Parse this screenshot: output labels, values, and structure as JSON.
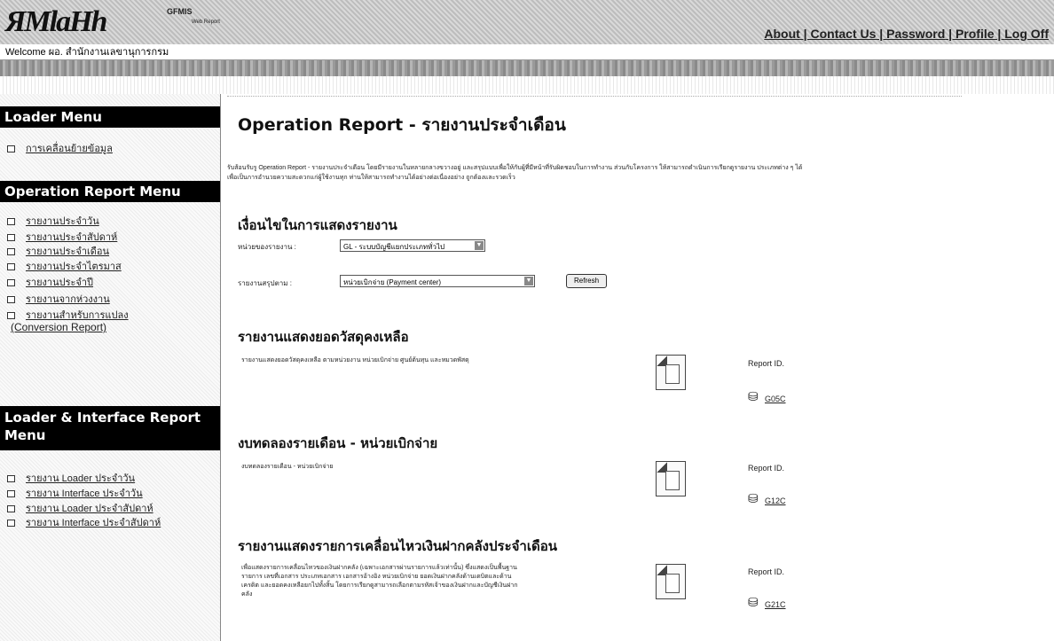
{
  "header": {
    "logo": "ЯMlaHh",
    "logo_sub": "GFMIS",
    "logo_sub2": "Web Report",
    "links": [
      "About",
      "Contact Us",
      "Password",
      "Profile",
      "Log Off"
    ],
    "separator": " | "
  },
  "welcome": "Welcome  ผอ. สำนักงานเลขานุการกรม",
  "sidebar": {
    "loader_menu": {
      "title": "Loader Menu",
      "items": [
        "การเคลื่อนย้ายข้อมูล"
      ]
    },
    "operation_menu": {
      "title": "Operation Report Menu",
      "items": [
        "รายงานประจำวัน",
        "รายงานประจำสัปดาห์",
        "รายงานประจำเดือน",
        "รายงานประจำไตรมาส",
        "รายงานประจำปี",
        "รายงานจากห่วงงาน",
        "รายงานสำหรับการแปลง",
        "(Conversion Report)"
      ]
    },
    "loader_interface_menu": {
      "title_line1": "Loader & Interface Report",
      "title_line2": "Menu",
      "items": [
        "รายงาน Loader ประจำวัน",
        "รายงาน Interface ประจำวัน",
        "รายงาน Loader ประจำสัปดาห์",
        "รายงาน Interface ประจำสัปดาห์"
      ]
    }
  },
  "main": {
    "title": "Operation Report -  รายงานประจำเดือน",
    "description_line1": "รับส้อนรับรู Operation Report - รายงานประจำเดือน โดยมีรายงานในหลายกลางขวางอยู่ และสรุปแบบเพื่อให้กับผู้ที่มีหน้าที่รับผิดชอบในการทำงาน ส่วนกับโครงการ ให้สามารถดำเนินการเรียกดูรายงาน ประเภทต่าง ๆ ได้",
    "description_line2": "เพื่อเป็นการอำนวยความสะดวกแก่ผู้ใช้งานทุก ท่านให้สามารถทำงานได้อย่างต่อเนื่องอย่าง ถูกต้องและรวดเร็ว",
    "conditions": {
      "title": "เงื่อนไขในการแสดงรายงาน",
      "field1_label": "หน่วยของรายงาน   :",
      "field1_value": "GL - ระบบบัญชีแยกประเภททั่วไป",
      "field2_label": "รายงานสรุปตาม    :",
      "field2_value": "หน่วยเบิกจ่าย (Payment center)",
      "refresh_label": "Refresh"
    },
    "reports": [
      {
        "title": "รายงานแสดงยอดวัสดุคงเหลือ",
        "desc": [
          "รายงานแสดงยอดวัสดุคงเหลือ ตามหน่วยงาน หน่วยเบิกจ่าย ศูนย์ต้นทุน และหมวดพัสดุ"
        ],
        "report_id_label": "Report ID.",
        "report_code": "G05C"
      },
      {
        "title": "งบทดลองรายเดือน - หน่วยเบิกจ่าย",
        "desc": [
          "งบทดลองรายเดือน - หน่วยเบิกจ่าย"
        ],
        "report_id_label": "Report ID.",
        "report_code": "G12C"
      },
      {
        "title": "รายงานแสดงรายการเคลื่อนไหวเงินฝากคลังประจำเดือน",
        "desc": [
          "เพื่อแสดงรายการเคลื่อนไหวของเงินฝากคลัง (เฉพาะเอกสารผ่านรายการแล้วเท่านั้น) ซึ่งแสดงเป็นพื้นฐาน",
          "รายการ เลขที่เอกสาร ประเภทเอกสาร เอกสารอ้างอิง หน่วยเบิกจ่าย ยอดเงินฝากคลังด้านเดบิตและด้าน",
          "เครดิต และยอดคงเหลือยกไปทั้งสิ้น โดยการเรียกดูสามารถเลือกตามรหัสเจ้าของเงินฝากและบัญชีเงินฝาก",
          "คลัง"
        ],
        "report_id_label": "Report ID.",
        "report_code": "G21C"
      }
    ]
  }
}
